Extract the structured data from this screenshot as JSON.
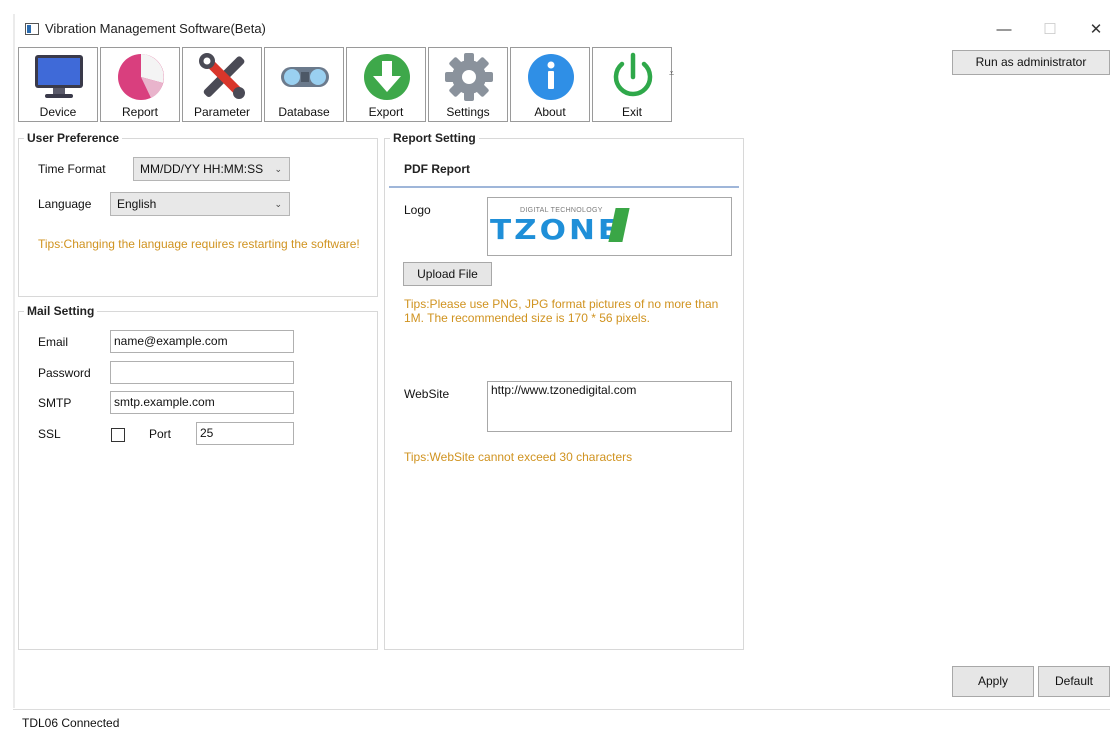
{
  "window": {
    "title": "Vibration Management Software(Beta)"
  },
  "toolbar": {
    "items": [
      {
        "label": "Device",
        "icon": "monitor-icon"
      },
      {
        "label": "Report",
        "icon": "pie-chart-icon"
      },
      {
        "label": "Parameter",
        "icon": "wrench-screwdriver-icon"
      },
      {
        "label": "Database",
        "icon": "binoculars-icon"
      },
      {
        "label": "Export",
        "icon": "download-icon"
      },
      {
        "label": "Settings",
        "icon": "gear-icon"
      },
      {
        "label": "About",
        "icon": "info-icon"
      },
      {
        "label": "Exit",
        "icon": "power-icon"
      }
    ],
    "more_glyph": "⩡"
  },
  "admin_button": "Run as administrator",
  "user_preference": {
    "title": "User Preference",
    "time_format_label": "Time Format",
    "time_format_value": "MM/DD/YY HH:MM:SS",
    "language_label": "Language",
    "language_value": "English",
    "tip": "Tips:Changing the language requires restarting the software!"
  },
  "mail_setting": {
    "title": "Mail Setting",
    "email_label": "Email",
    "email_value": "name@example.com",
    "password_label": "Password",
    "password_value": "",
    "smtp_label": "SMTP",
    "smtp_value": "smtp.example.com",
    "ssl_label": "SSL",
    "ssl_checked": false,
    "port_label": "Port",
    "port_value": "25"
  },
  "report_setting": {
    "title": "Report Setting",
    "pdf_header": "PDF Report",
    "logo_label": "Logo",
    "logo_tagline": "DIGITAL TECHNOLOGY",
    "logo_brand": "TZONE",
    "upload_button": "Upload File",
    "logo_tip": "Tips:Please use PNG, JPG format pictures of no more than 1M. The recommended size is 170 * 56 pixels.",
    "website_label": "WebSite",
    "website_value": "http://www.tzonedigital.com",
    "website_tip": "Tips:WebSite cannot exceed 30 characters"
  },
  "buttons": {
    "apply": "Apply",
    "default": "Default"
  },
  "status": {
    "text": "TDL06 Connected"
  },
  "colors": {
    "tip": "#d09320",
    "accent_line": "#9fb6d9",
    "logo_blue": "#1f8fd8",
    "logo_green": "#3aa646"
  }
}
